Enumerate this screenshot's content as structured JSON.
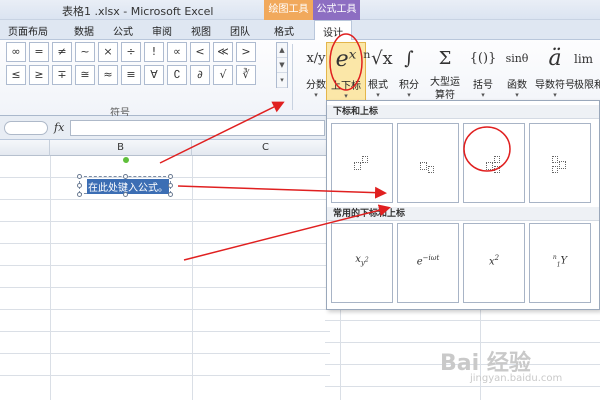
{
  "window": {
    "title": "表格1 .xlsx - Microsoft Excel"
  },
  "context_tabs": {
    "drawing_tools": "绘图工具",
    "equation_tools": "公式工具"
  },
  "tabs": [
    "页面布局",
    "数据",
    "公式",
    "审阅",
    "视图",
    "团队",
    "格式",
    "设计"
  ],
  "symbols": {
    "row1": [
      "∞",
      "=",
      "≠",
      "~",
      "×",
      "÷",
      "!",
      "∝",
      "<",
      "≪",
      ">"
    ],
    "row2": [
      "≤",
      "≥",
      "∓",
      "≅",
      "≈",
      "≡",
      "∀",
      "∁",
      "∂",
      "√",
      "∛"
    ],
    "scroll": [
      "▲",
      "▼",
      "▾"
    ],
    "group_label": "符号"
  },
  "structures": [
    {
      "glyph": "x/y",
      "label": "分数",
      "caret": "▾"
    },
    {
      "glyph": "eˣ",
      "label": "上下标",
      "caret": "▾"
    },
    {
      "glyph": "ⁿ√x",
      "label": "根式",
      "caret": "▾"
    },
    {
      "glyph": "∫",
      "label": "积分",
      "caret": "▾"
    },
    {
      "glyph": "Σ",
      "label": "大型运算符",
      "caret": "▾"
    },
    {
      "glyph": "{()}",
      "label": "括号",
      "caret": "▾"
    },
    {
      "glyph": "sinθ",
      "label": "函数",
      "caret": "▾"
    },
    {
      "glyph": "ä",
      "label": "导数符号",
      "caret": "▾"
    },
    {
      "glyph": "lim",
      "label": "极限和",
      "caret": ""
    }
  ],
  "formula_bar": {
    "fx": "fx"
  },
  "columns": [
    "B",
    "C"
  ],
  "textbox": {
    "text": "在此处键入公式。"
  },
  "dropdown": {
    "section1": "下标和上标",
    "section2": "常用的下标和上标",
    "common": [
      "x_{y^2}",
      "e^{-iωt}",
      "x²",
      "ⁿ₁Y"
    ]
  },
  "watermark": {
    "text": "Bai 经验",
    "url": "jingyan.baidu.com"
  },
  "colors": {
    "accent_red": "#e02020",
    "drawing_tab": "#f1a95c",
    "equation_tab": "#8d6ec2"
  }
}
